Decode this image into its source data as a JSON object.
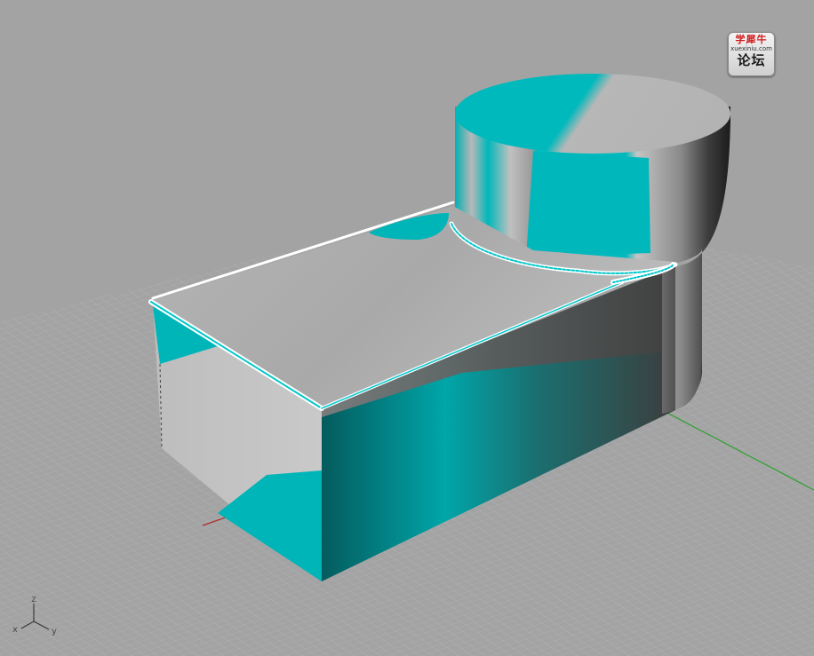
{
  "viewport": {
    "background_color": "#a3a3a3",
    "grid_color": "#b9bfc4",
    "model_colors": {
      "cyan": "#00b5b8",
      "dark_cyan": "#045a5c",
      "silver": "#b2b2b2",
      "dark_gray": "#4e4e4e"
    },
    "axis_colors": {
      "x": "#b22a2a",
      "y": "#2ea02e"
    }
  },
  "axis_triad": {
    "z_label": "z",
    "x_label": "x",
    "y_label": "y"
  },
  "watermark": {
    "line1": "学犀牛",
    "line2": "xuexiniu.com",
    "line3": "论坛"
  }
}
